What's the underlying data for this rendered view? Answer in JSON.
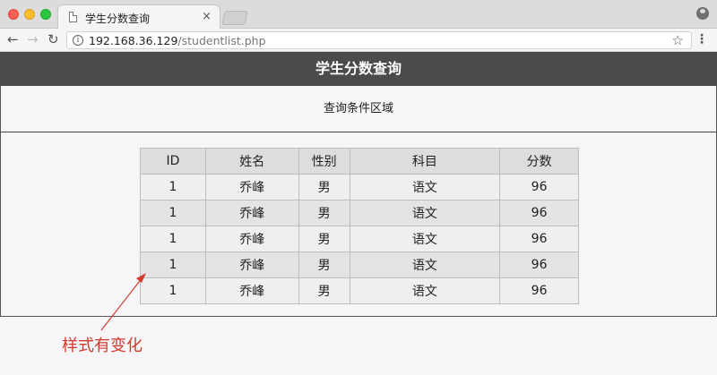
{
  "browser": {
    "tab_title": "学生分数查询",
    "tab_close": "×",
    "url_host": "192.168.36.129",
    "url_path": "/studentlist.php"
  },
  "page": {
    "header_title": "学生分数查询",
    "query_area_label": "查询条件区域"
  },
  "table": {
    "headers": [
      "ID",
      "姓名",
      "性别",
      "科目",
      "分数"
    ],
    "rows": [
      [
        "1",
        "乔峰",
        "男",
        "语文",
        "96"
      ],
      [
        "1",
        "乔峰",
        "男",
        "语文",
        "96"
      ],
      [
        "1",
        "乔峰",
        "男",
        "语文",
        "96"
      ],
      [
        "1",
        "乔峰",
        "男",
        "语文",
        "96"
      ],
      [
        "1",
        "乔峰",
        "男",
        "语文",
        "96"
      ]
    ]
  },
  "annotation": {
    "text": "样式有变化",
    "color": "#d23b2f"
  },
  "colors": {
    "header_bg": "#4b4a4c",
    "page_bg": "#f6f5f7"
  }
}
